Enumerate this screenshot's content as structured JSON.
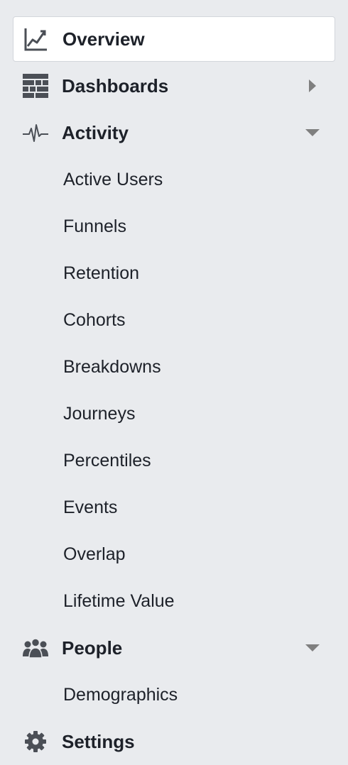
{
  "nav": {
    "overview": {
      "label": "Overview",
      "icon": "chart-line-icon"
    },
    "dashboards": {
      "label": "Dashboards",
      "icon": "grid-icon",
      "caret": "caret-right-icon"
    },
    "activity": {
      "label": "Activity",
      "icon": "pulse-icon",
      "caret": "caret-down-icon",
      "items": [
        "Active Users",
        "Funnels",
        "Retention",
        "Cohorts",
        "Breakdowns",
        "Journeys",
        "Percentiles",
        "Events",
        "Overlap",
        "Lifetime Value"
      ]
    },
    "people": {
      "label": "People",
      "icon": "people-icon",
      "caret": "caret-down-icon",
      "items": [
        "Demographics"
      ]
    },
    "settings": {
      "label": "Settings",
      "icon": "gear-icon"
    }
  },
  "colors": {
    "background": "#e9ebee",
    "selected_bg": "#ffffff",
    "text": "#1d2129",
    "icon": "#4b4f56",
    "caret": "#7f7f7f"
  }
}
